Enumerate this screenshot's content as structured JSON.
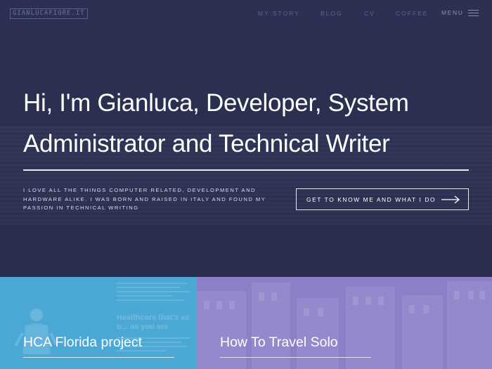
{
  "site": {
    "logo": "GIANLUCAFIORE.IT"
  },
  "nav": {
    "items": [
      {
        "label": "MY STORY"
      },
      {
        "label": "BLOG"
      },
      {
        "label": "CV"
      },
      {
        "label": "COFFEE"
      }
    ],
    "menu_label": "MENU"
  },
  "hero": {
    "headline": "Hi, I'm Gianluca, Developer, System Administrator and Technical Writer",
    "intro": "I love all the things computer related, development and hardware alike. I was born and raised in Italy and found my passion in technical writing",
    "cta_label": "GET TO KNOW ME AND WHAT I DO"
  },
  "cards": [
    {
      "title": "HCA Florida project",
      "color": "#4ba8d5",
      "background_text": "Healthcare that's as o... as you are"
    },
    {
      "title": "How To Travel Solo",
      "color": "#8b7fc8"
    }
  ],
  "colors": {
    "hero_bg": "#2b2f50",
    "text": "#ffffff",
    "nav_text": "#5f658a"
  }
}
